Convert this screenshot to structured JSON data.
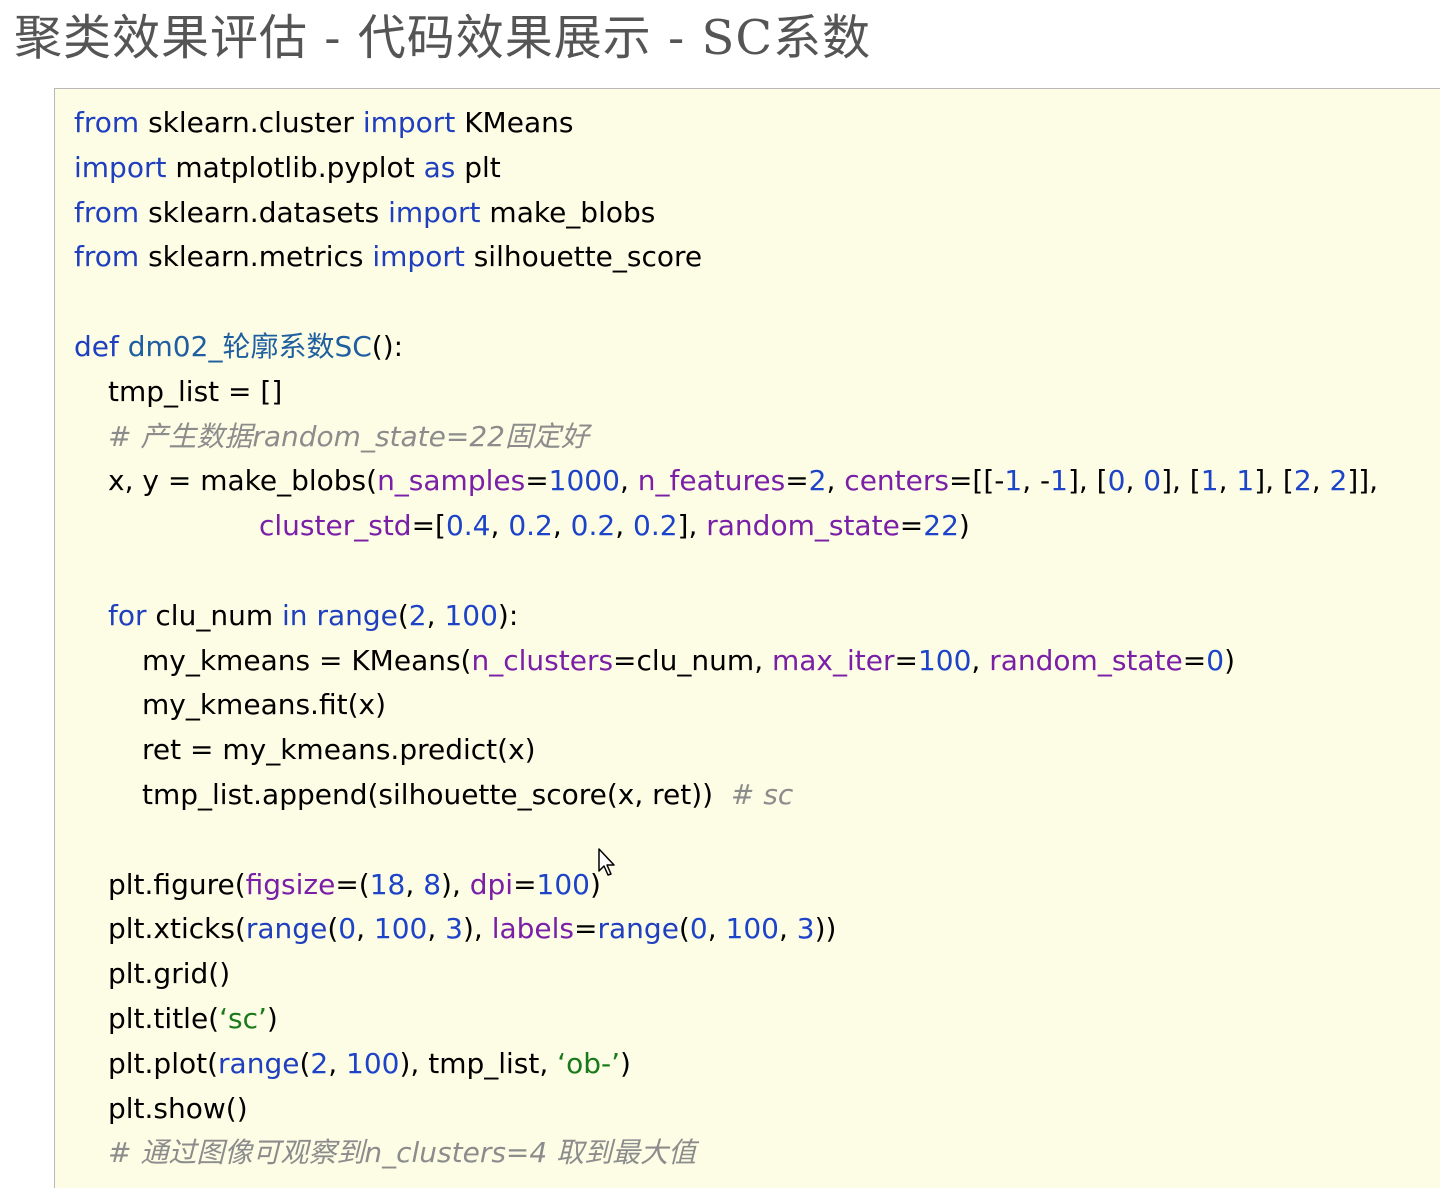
{
  "slide": {
    "title": "聚类效果评估 - 代码效果展示 - SC系数"
  },
  "code": {
    "lines": [
      [
        [
          "kw",
          "from"
        ],
        [
          "txt",
          " sklearn.cluster "
        ],
        [
          "kw",
          "import"
        ],
        [
          "txt",
          " KMeans"
        ]
      ],
      [
        [
          "kw",
          "import"
        ],
        [
          "txt",
          " matplotlib.pyplot "
        ],
        [
          "kw",
          "as"
        ],
        [
          "txt",
          " plt"
        ]
      ],
      [
        [
          "kw",
          "from"
        ],
        [
          "txt",
          " sklearn.datasets "
        ],
        [
          "kw",
          "import"
        ],
        [
          "txt",
          " make_blobs"
        ]
      ],
      [
        [
          "kw",
          "from"
        ],
        [
          "txt",
          " sklearn.metrics "
        ],
        [
          "kw",
          "import"
        ],
        [
          "txt",
          " silhouette_score"
        ]
      ],
      [],
      [
        [
          "kw",
          "def"
        ],
        [
          "fn",
          " dm02_轮廓系数SC"
        ],
        [
          "txt",
          "():"
        ]
      ],
      [
        [
          "txt",
          "tmp_list = []"
        ]
      ],
      [
        [
          "comment",
          "# 产生数据random_state=22固定好"
        ]
      ],
      [
        [
          "txt",
          "x, y = make_blobs("
        ],
        [
          "arg",
          "n_samples"
        ],
        [
          "txt",
          "="
        ],
        [
          "num",
          "1000"
        ],
        [
          "txt",
          ", "
        ],
        [
          "arg",
          "n_features"
        ],
        [
          "txt",
          "="
        ],
        [
          "num",
          "2"
        ],
        [
          "txt",
          ", "
        ],
        [
          "arg",
          "centers"
        ],
        [
          "txt",
          "=[[-"
        ],
        [
          "num",
          "1"
        ],
        [
          "txt",
          ", -"
        ],
        [
          "num",
          "1"
        ],
        [
          "txt",
          "], ["
        ],
        [
          "num",
          "0"
        ],
        [
          "txt",
          ", "
        ],
        [
          "num",
          "0"
        ],
        [
          "txt",
          "], ["
        ],
        [
          "num",
          "1"
        ],
        [
          "txt",
          ", "
        ],
        [
          "num",
          "1"
        ],
        [
          "txt",
          "], ["
        ],
        [
          "num",
          "2"
        ],
        [
          "txt",
          ", "
        ],
        [
          "num",
          "2"
        ],
        [
          "txt",
          "]],"
        ]
      ],
      [
        [
          "arg",
          "cluster_std"
        ],
        [
          "txt",
          "=["
        ],
        [
          "num",
          "0.4"
        ],
        [
          "txt",
          ", "
        ],
        [
          "num",
          "0.2"
        ],
        [
          "txt",
          ", "
        ],
        [
          "num",
          "0.2"
        ],
        [
          "txt",
          ", "
        ],
        [
          "num",
          "0.2"
        ],
        [
          "txt",
          "], "
        ],
        [
          "arg",
          "random_state"
        ],
        [
          "txt",
          "="
        ],
        [
          "num",
          "22"
        ],
        [
          "txt",
          ")"
        ]
      ],
      [],
      [
        [
          "kw",
          "for"
        ],
        [
          "txt",
          " clu_num "
        ],
        [
          "kw",
          "in"
        ],
        [
          "txt",
          " "
        ],
        [
          "kw",
          "range"
        ],
        [
          "txt",
          "("
        ],
        [
          "num",
          "2"
        ],
        [
          "txt",
          ", "
        ],
        [
          "num",
          "100"
        ],
        [
          "txt",
          "):"
        ]
      ],
      [
        [
          "txt",
          "my_kmeans = KMeans("
        ],
        [
          "arg",
          "n_clusters"
        ],
        [
          "txt",
          "=clu_num, "
        ],
        [
          "arg",
          "max_iter"
        ],
        [
          "txt",
          "="
        ],
        [
          "num",
          "100"
        ],
        [
          "txt",
          ", "
        ],
        [
          "arg",
          "random_state"
        ],
        [
          "txt",
          "="
        ],
        [
          "num",
          "0"
        ],
        [
          "txt",
          ")"
        ]
      ],
      [
        [
          "txt",
          "my_kmeans.fit(x)"
        ]
      ],
      [
        [
          "txt",
          "ret = my_kmeans.predict(x)"
        ]
      ],
      [
        [
          "txt",
          "tmp_list.append(silhouette_score(x, ret))  "
        ],
        [
          "comment",
          "# sc"
        ]
      ],
      [],
      [
        [
          "txt",
          "plt.figure("
        ],
        [
          "arg",
          "figsize"
        ],
        [
          "txt",
          "=("
        ],
        [
          "num",
          "18"
        ],
        [
          "txt",
          ", "
        ],
        [
          "num",
          "8"
        ],
        [
          "txt",
          "), "
        ],
        [
          "arg",
          "dpi"
        ],
        [
          "txt",
          "="
        ],
        [
          "num",
          "100"
        ],
        [
          "txt",
          ")"
        ]
      ],
      [
        [
          "txt",
          "plt.xticks("
        ],
        [
          "kw",
          "range"
        ],
        [
          "txt",
          "("
        ],
        [
          "num",
          "0"
        ],
        [
          "txt",
          ", "
        ],
        [
          "num",
          "100"
        ],
        [
          "txt",
          ", "
        ],
        [
          "num",
          "3"
        ],
        [
          "txt",
          "), "
        ],
        [
          "arg",
          "labels"
        ],
        [
          "txt",
          "="
        ],
        [
          "kw",
          "range"
        ],
        [
          "txt",
          "("
        ],
        [
          "num",
          "0"
        ],
        [
          "txt",
          ", "
        ],
        [
          "num",
          "100"
        ],
        [
          "txt",
          ", "
        ],
        [
          "num",
          "3"
        ],
        [
          "txt",
          "))"
        ]
      ],
      [
        [
          "txt",
          "plt.grid()"
        ]
      ],
      [
        [
          "txt",
          "plt.title("
        ],
        [
          "str",
          "‘sc’"
        ],
        [
          "txt",
          ")"
        ]
      ],
      [
        [
          "txt",
          "plt.plot("
        ],
        [
          "kw",
          "range"
        ],
        [
          "txt",
          "("
        ],
        [
          "num",
          "2"
        ],
        [
          "txt",
          ", "
        ],
        [
          "num",
          "100"
        ],
        [
          "txt",
          "), tmp_list, "
        ],
        [
          "str",
          "‘ob-’"
        ],
        [
          "txt",
          ")"
        ]
      ],
      [
        [
          "txt",
          "plt.show()"
        ]
      ],
      [
        [
          "comment",
          "# 通过图像可观察到n_clusters=4 取到最大值"
        ]
      ]
    ]
  }
}
